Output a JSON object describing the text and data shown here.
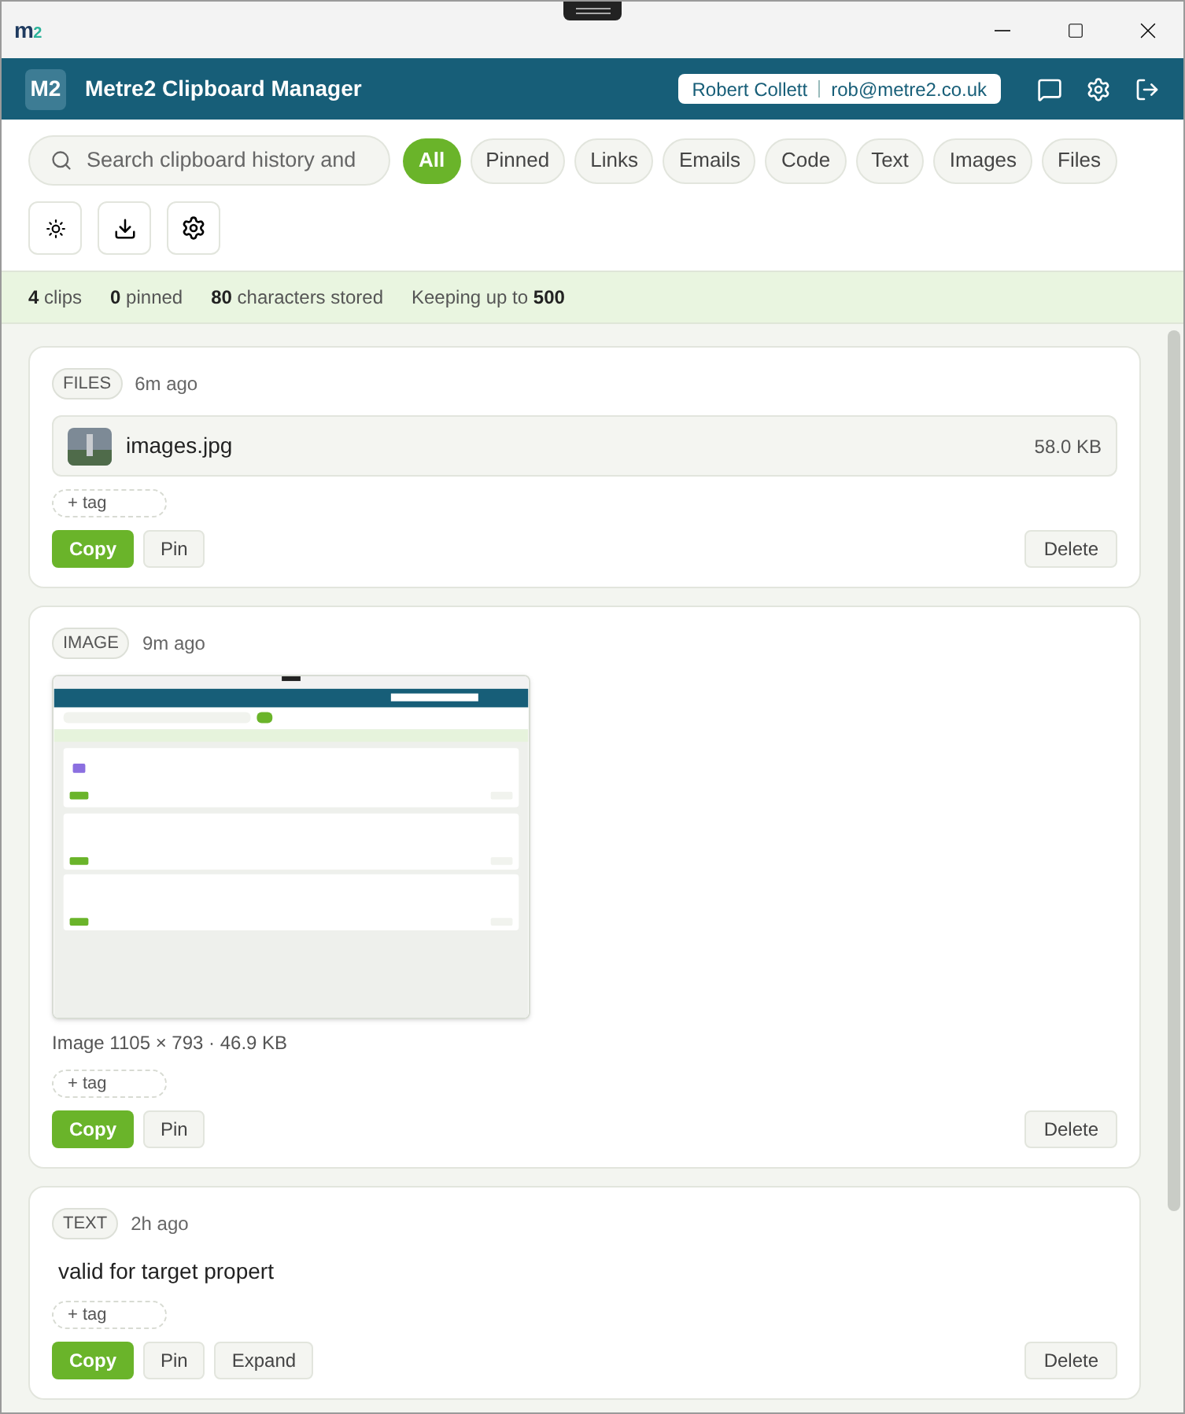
{
  "window": {
    "logo_letter": "m",
    "logo_digit": "2"
  },
  "header": {
    "badge": "M2",
    "title": "Metre2 Clipboard Manager",
    "user_name": "Robert Collett",
    "user_email": "rob@metre2.co.uk"
  },
  "search": {
    "placeholder": "Search clipboard history and"
  },
  "filters": [
    {
      "label": "All",
      "selected": true
    },
    {
      "label": "Pinned",
      "selected": false
    },
    {
      "label": "Links",
      "selected": false
    },
    {
      "label": "Emails",
      "selected": false
    },
    {
      "label": "Code",
      "selected": false
    },
    {
      "label": "Text",
      "selected": false
    },
    {
      "label": "Images",
      "selected": false
    },
    {
      "label": "Files",
      "selected": false
    }
  ],
  "stats": [
    "**4** clips",
    "**0** pinned",
    "**80** characters stored",
    "Keeping up to **500**"
  ],
  "clips": [
    {
      "kind": "file",
      "type_label": "FILES",
      "time": "6m ago",
      "file_name": "images.jpg",
      "file_size": "58.0 KB",
      "tag_label": "+ tag",
      "actions": [
        {
          "label": "Copy",
          "primary": true
        },
        {
          "label": "Pin",
          "primary": false
        }
      ],
      "delete_label": "Delete"
    },
    {
      "kind": "image",
      "type_label": "IMAGE",
      "time": "9m ago",
      "caption": "Image 1105 × 793 · 46.9 KB",
      "tag_label": "+ tag",
      "actions": [
        {
          "label": "Copy",
          "primary": true
        },
        {
          "label": "Pin",
          "primary": false
        }
      ],
      "delete_label": "Delete"
    },
    {
      "kind": "text",
      "type_label": "TEXT",
      "time": "2h ago",
      "text": "valid for target propert",
      "tag_label": "+ tag",
      "actions": [
        {
          "label": "Copy",
          "primary": true
        },
        {
          "label": "Pin",
          "primary": false
        },
        {
          "label": "Expand",
          "primary": false
        }
      ],
      "delete_label": "Delete"
    }
  ]
}
